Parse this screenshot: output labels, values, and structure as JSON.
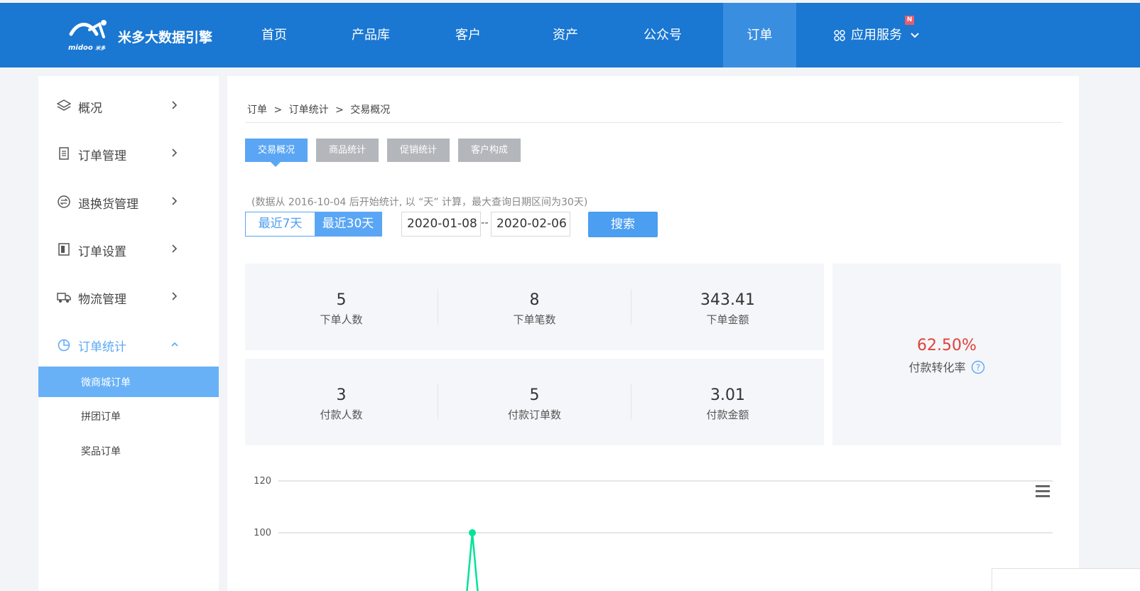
{
  "brand": {
    "name": "米多大数据引擎",
    "sub": "midoo",
    "sub_small": "米多"
  },
  "nav": {
    "items": [
      "首页",
      "产品库",
      "客户",
      "资产",
      "公众号",
      "订单"
    ],
    "app_service": "应用服务",
    "badge": "N",
    "active": "订单"
  },
  "sidebar": {
    "items": [
      {
        "label": "概况",
        "icon": "layers-icon"
      },
      {
        "label": "订单管理",
        "icon": "document-icon"
      },
      {
        "label": "退换货管理",
        "icon": "exchange-icon"
      },
      {
        "label": "订单设置",
        "icon": "settings-doc-icon"
      },
      {
        "label": "物流管理",
        "icon": "truck-icon"
      },
      {
        "label": "订单统计",
        "icon": "pie-chart-icon"
      }
    ],
    "sub_items": [
      "微商城订单",
      "拼团订单",
      "奖品订单"
    ],
    "active_sub": "微商城订单"
  },
  "breadcrumb": [
    "订单",
    "订单统计",
    "交易概况"
  ],
  "breadcrumb_sep": ">",
  "tabs": [
    "交易概况",
    "商品统计",
    "促销统计",
    "客户构成"
  ],
  "note": "(数据从 2016-10-04 后开始统计, 以 “天” 计算，最大查询日期区间为30天)",
  "range": {
    "options": [
      "最近7天",
      "最近30天"
    ],
    "selected": "最近30天"
  },
  "dates": {
    "start": "2020-01-08",
    "end": "2020-02-06",
    "sep": "--"
  },
  "search_label": "搜索",
  "stats": {
    "order": [
      {
        "value": "5",
        "label": "下单人数"
      },
      {
        "value": "8",
        "label": "下单笔数"
      },
      {
        "value": "343.41",
        "label": "下单金额"
      }
    ],
    "pay": [
      {
        "value": "3",
        "label": "付款人数"
      },
      {
        "value": "5",
        "label": "付款订单数"
      },
      {
        "value": "3.01",
        "label": "付款金额"
      }
    ],
    "conversion": {
      "value": "62.50%",
      "label": "付款转化率",
      "help_icon": "question-circle-icon"
    }
  },
  "chart_data": {
    "type": "line",
    "y_ticks": [
      120,
      100
    ],
    "ylim_visible": [
      90,
      120
    ],
    "grid": true,
    "series": [
      {
        "values_visible": [
          100
        ],
        "color": "#00e39a"
      }
    ],
    "menu_icon": "hamburger-icon"
  },
  "colors": {
    "nav": "#1a77d2",
    "accent": "#5aa6f5",
    "tab_inactive": "#b3b6bb",
    "conversion": "#e0423a",
    "line": "#00e39a"
  }
}
